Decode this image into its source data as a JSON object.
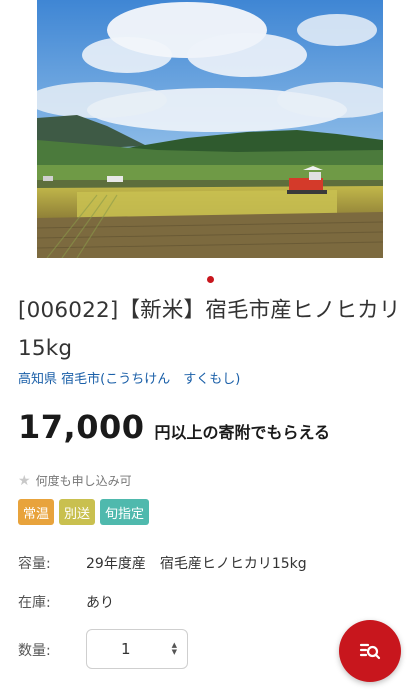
{
  "product": {
    "image_alt": "rice field harvest landscape",
    "carousel_active_dot_color": "#c8161d",
    "title": "[006022]【新米】宿毛市産ヒノヒカリ 15kg",
    "region": "高知県 宿毛市(こうちけん　すくもし)",
    "price_amount": "17,000",
    "price_suffix": "円以上の寄附でもらえる",
    "repeat_note": "何度も申し込み可",
    "tags": [
      {
        "label": "常温",
        "color": "#e8a33c"
      },
      {
        "label": "別送",
        "color": "#c9c04f"
      },
      {
        "label": "旬指定",
        "color": "#4fb9ad"
      }
    ],
    "specs": {
      "capacity_label": "容量:",
      "capacity_value": "29年度産　宿毛産ヒノヒカリ15kg",
      "stock_label": "在庫:",
      "stock_value": "あり",
      "quantity_label": "数量:"
    },
    "quantity": {
      "value": "1",
      "icon": "up-down-arrows-icon"
    }
  },
  "fab": {
    "icon": "search-list-icon",
    "color": "#c8161d"
  }
}
